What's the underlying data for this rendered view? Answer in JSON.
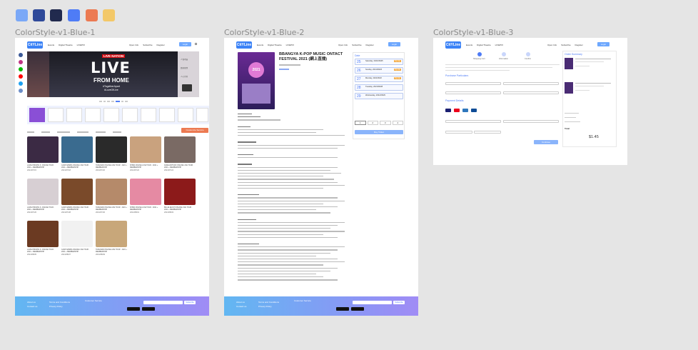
{
  "colors": {
    "palette": [
      "#7aa8f7",
      "#2f4a9a",
      "#212a4e",
      "#4f7cf6",
      "#ec7a52",
      "#f3c868"
    ],
    "accent": "#6ea8fe",
    "brand": "#3b82f6",
    "footer_gradient": [
      "#62b7f2",
      "#a08cf5"
    ],
    "badge_orange": "#f3a73b"
  },
  "frames": [
    {
      "label": "ColorStyle-v1-Blue-1"
    },
    {
      "label": "ColorStyle-v1-Blue-2"
    },
    {
      "label": "ColorStyle-v1-Blue-3"
    }
  ],
  "header": {
    "logo_text": "CitYLine",
    "nav_items": [
      "Events",
      "Digital Theatre",
      "LIVEPIX"
    ],
    "right_items": [
      "Open Info",
      "Subscribe",
      "Register"
    ],
    "login_label": "Login"
  },
  "blue1": {
    "hero_brand": "LIVE NATION",
    "hero_title": "LIVE",
    "hero_subtitle": "FROM HOME",
    "hero_tags": [
      "#TogetherApart",
      "#LoveOfLive"
    ],
    "hero_side_text": [
      "人傑地靈",
      "數碼娛樂",
      "人心所向"
    ],
    "filter_button": "Customize Service",
    "cards": [
      {
        "title": "LAVIE PRIVATE S. ONLINE TOUR · 2021 + MEMBERSHIP",
        "meta": "2021/07/15"
      },
      {
        "title": "GUMI NAMBA ONLINE LIVE TOUR · 2021 + MEMBERSHIP",
        "meta": "2021/07/18"
      },
      {
        "title": "TAKIZAWA ONLINE LIVE TOUR · 2021 + MEMBERSHIP",
        "meta": "2021/07/20"
      },
      {
        "title": "SHIBA ONLINE LIVE TOUR · 2021 + MEMBERSHIP",
        "meta": "2021/07/22"
      },
      {
        "title": "KADE WATSON ONLINE LIVE TOUR · 2021 + MEMBERSHIP",
        "meta": "2021/07/24"
      },
      {
        "title": "LAVIE PRIVATE S. ONLINE TOUR · 2021 + MEMBERSHIP",
        "meta": "2021/07/26"
      },
      {
        "title": "GUMI NAMBA ONLINE LIVE TOUR · 2021 + MEMBERSHIP",
        "meta": "2021/07/28"
      },
      {
        "title": "TAKIZAWA ONLINE LIVE TOUR · 2021 + MEMBERSHIP",
        "meta": "2021/07/30"
      },
      {
        "title": "SHIBA ONLINE LIVE TOUR · 2021 + MEMBERSHIP",
        "meta": "2021/08/01"
      },
      {
        "title": "BILLIE EILISH ONLINE LIVE TOUR · 2021 + MEMBERSHIP",
        "meta": "2021/08/03"
      },
      {
        "title": "LAVIE PRIVATE S. ONLINE TOUR · 2021 + MEMBERSHIP",
        "meta": "2021/08/05"
      },
      {
        "title": "GUMI NAMBA ONLINE LIVE TOUR · 2021 + MEMBERSHIP",
        "meta": "2021/08/07"
      },
      {
        "title": "TAKIZAWA ONLINE LIVE TOUR · 2021 + MEMBERSHIP",
        "meta": "2021/08/09"
      }
    ]
  },
  "blue2": {
    "event_title": "BBANGYA K-POP MUSIC ONTACT FESTIVAL 2021 (網上直播)",
    "poster_year": "2021",
    "date_title": "Date",
    "dates": [
      {
        "day": "25",
        "text": "Saturday, 2021/09/25",
        "badge": "Popular"
      },
      {
        "day": "26",
        "text": "Sunday, 2021/09/26",
        "badge": "Popular"
      },
      {
        "day": "27",
        "text": "Monday, 2021/09/27",
        "badge": "Popular"
      },
      {
        "day": "28",
        "text": "Tuesday, 2021/09/28",
        "badge": ""
      },
      {
        "day": "29",
        "text": "Wednesday, 2021/09/29",
        "badge": ""
      }
    ],
    "qty_options": [
      "1",
      "2",
      "3",
      "4"
    ],
    "buy_label": "Buy Ticket"
  },
  "blue3": {
    "steps": [
      "Shopping Cart",
      "Information",
      "Confirm"
    ],
    "form_title": "Purchase Particulars",
    "payment_title": "Payment Details",
    "summary_title": "Order Summary",
    "total_label": "Total",
    "total_value": "$1.45",
    "submit_label": "Continue"
  },
  "footer": {
    "links": [
      "About us",
      "Contact us",
      "Terms and Conditions",
      "Privacy Policy",
      "Customer Service"
    ],
    "subscribe_label": "Subscribe"
  }
}
